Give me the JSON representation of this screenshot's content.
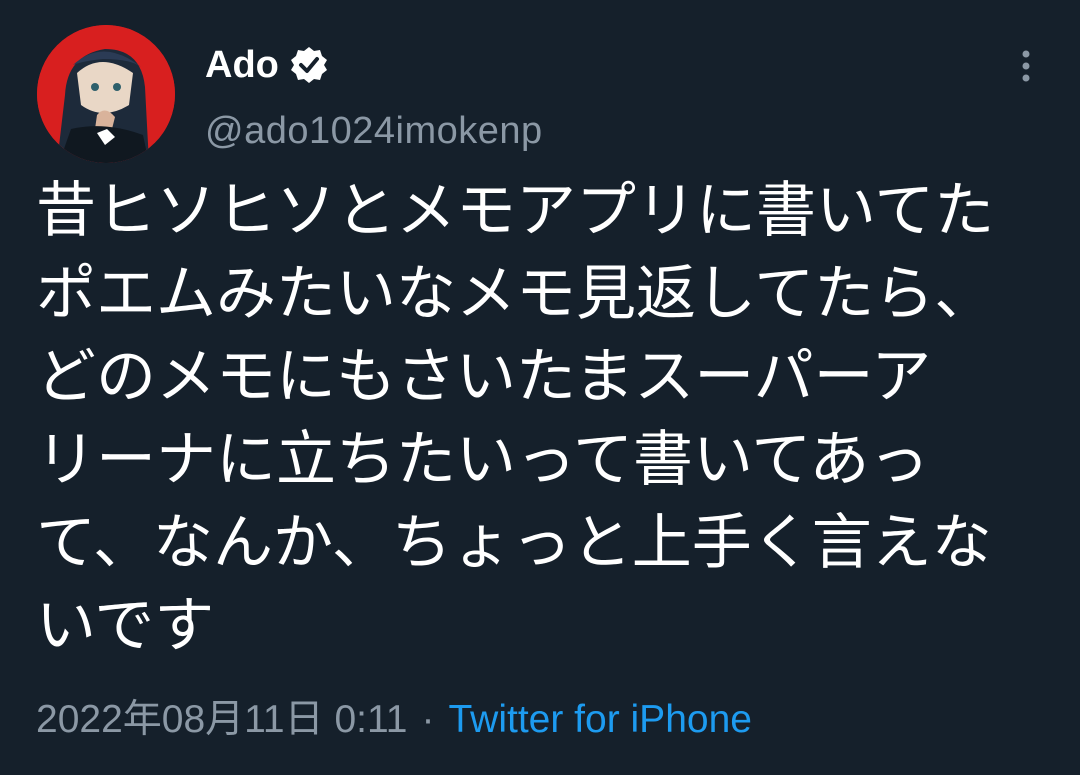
{
  "author": {
    "name": "Ado",
    "handle": "@ado1024imokenp",
    "verified": true,
    "avatar": "avatar-illustration"
  },
  "tweet": {
    "text": "昔ヒソヒソとメモアプリに書いてた\nポエムみたいなメモ見返してたら、\nどのメモにもさいたまスーパーア\nリーナに立ちたいって書いてあっ\nて、なんか、ちょっと上手く言えな\nいです",
    "date": "2022年08月11日 0:11",
    "separator": "·",
    "source": "Twitter for iPhone"
  },
  "icons": {
    "verified": "verified-badge-icon",
    "more": "more-options-icon"
  },
  "colors": {
    "background": "#15202b",
    "text": "#ffffff",
    "muted": "#8b98a5",
    "link": "#1d9bf0",
    "avatar_bg": "#d81f1f"
  }
}
